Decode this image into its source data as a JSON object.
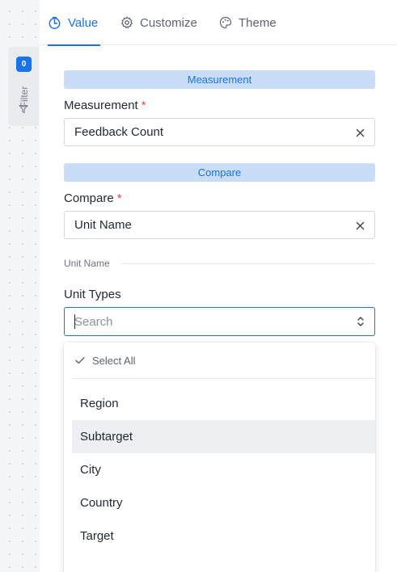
{
  "filter": {
    "count": "0",
    "label": "Filter"
  },
  "tabs": [
    {
      "label": "Value",
      "icon": "timer-icon",
      "active": true
    },
    {
      "label": "Customize",
      "icon": "gear-icon",
      "active": false
    },
    {
      "label": "Theme",
      "icon": "palette-icon",
      "active": false
    }
  ],
  "measurement_section": {
    "banner": "Measurement"
  },
  "measurement_field": {
    "label": "Measurement",
    "required": "*",
    "value": "Feedback Count"
  },
  "compare_section": {
    "banner": "Compare"
  },
  "compare_field": {
    "label": "Compare",
    "required": "*",
    "value": "Unit Name"
  },
  "unit_name_divider": {
    "text": "Unit Name"
  },
  "unit_types": {
    "label": "Unit Types",
    "search_placeholder": "Search",
    "search_value": ""
  },
  "dropdown": {
    "select_all": "Select All",
    "options": [
      "Region",
      "Subtarget",
      "City",
      "Country",
      "Target"
    ],
    "hovered_option": "Subtarget"
  },
  "colors": {
    "accent": "#1a73e8",
    "banner_bg": "#c9ddf7",
    "required": "#e5484d",
    "hover_bg": "#eeeff2"
  }
}
